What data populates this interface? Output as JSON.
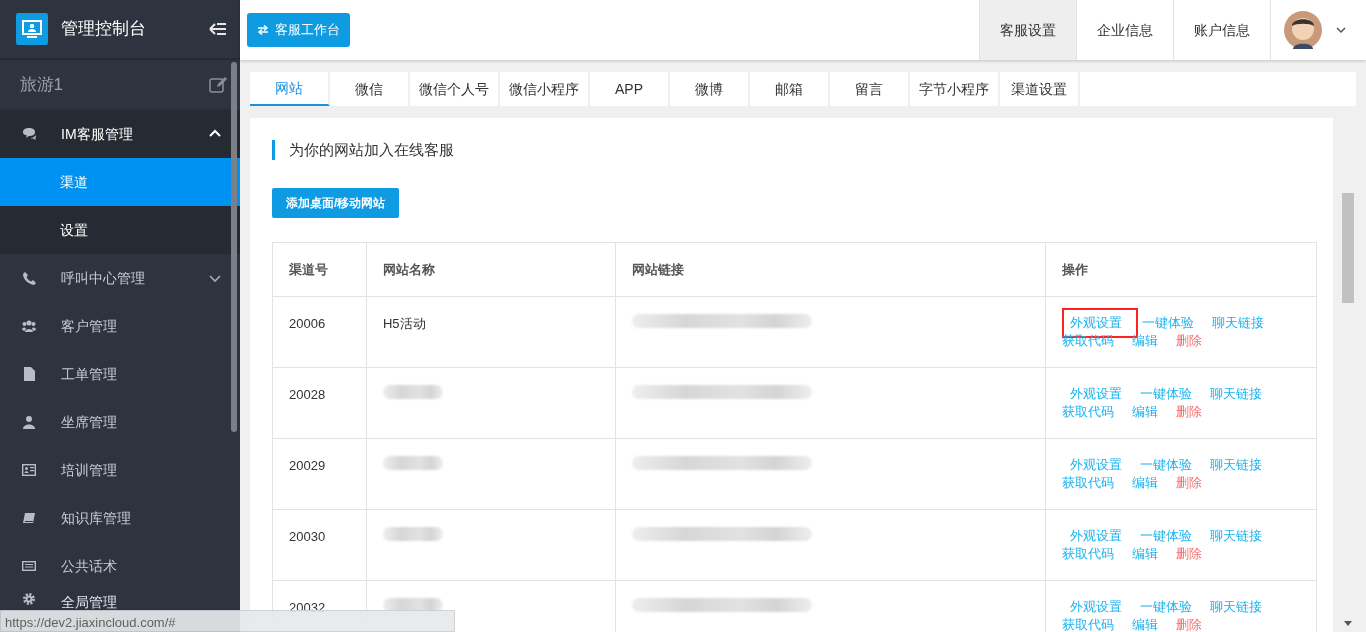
{
  "sidebar": {
    "title": "管理控制台",
    "account": "旅游1",
    "items": [
      {
        "label": "IM客服管理",
        "expanded": true,
        "children": [
          {
            "label": "渠道",
            "selected": true
          },
          {
            "label": "设置",
            "selected": false
          }
        ]
      },
      {
        "label": "呼叫中心管理",
        "expanded": false
      },
      {
        "label": "客户管理"
      },
      {
        "label": "工单管理"
      },
      {
        "label": "坐席管理"
      },
      {
        "label": "培训管理"
      },
      {
        "label": "知识库管理"
      },
      {
        "label": "公共话术"
      },
      {
        "label": "全局管理"
      }
    ]
  },
  "header": {
    "workbench_button": "客服工作台",
    "nav": [
      {
        "label": "客服设置",
        "selected": true
      },
      {
        "label": "企业信息",
        "selected": false
      },
      {
        "label": "账户信息",
        "selected": false
      }
    ]
  },
  "tabs": [
    {
      "label": "网站",
      "selected": true
    },
    {
      "label": "微信",
      "selected": false
    },
    {
      "label": "微信个人号",
      "selected": false
    },
    {
      "label": "微信小程序",
      "selected": false
    },
    {
      "label": "APP",
      "selected": false
    },
    {
      "label": "微博",
      "selected": false
    },
    {
      "label": "邮箱",
      "selected": false
    },
    {
      "label": "留言",
      "selected": false
    },
    {
      "label": "字节小程序",
      "selected": false
    },
    {
      "label": "渠道设置",
      "selected": false
    }
  ],
  "section_title": "为你的网站加入在线客服",
  "add_button": "添加桌面/移动网站",
  "table": {
    "columns": [
      "渠道号",
      "网站名称",
      "网站链接",
      "操作"
    ],
    "rows": [
      {
        "channel": "20006",
        "name": "H5活动",
        "name_redacted": false,
        "link_redacted": true,
        "actions": [
          {
            "label": "外观设置",
            "kind": "link",
            "highlighted": true
          },
          {
            "label": "一键体验",
            "kind": "link",
            "highlighted": false
          },
          {
            "label": "聊天链接",
            "kind": "link",
            "highlighted": false
          },
          {
            "label": "获取代码",
            "kind": "link",
            "highlighted": false
          },
          {
            "label": "编辑",
            "kind": "link",
            "highlighted": false
          },
          {
            "label": "删除",
            "kind": "danger",
            "highlighted": false
          }
        ]
      },
      {
        "channel": "20028",
        "name_redacted": true,
        "link_redacted": true,
        "actions": [
          {
            "label": "外观设置",
            "kind": "link",
            "highlighted": false
          },
          {
            "label": "一键体验",
            "kind": "link",
            "highlighted": false
          },
          {
            "label": "聊天链接",
            "kind": "link",
            "highlighted": false
          },
          {
            "label": "获取代码",
            "kind": "link",
            "highlighted": false
          },
          {
            "label": "编辑",
            "kind": "link",
            "highlighted": false
          },
          {
            "label": "删除",
            "kind": "danger",
            "highlighted": false
          }
        ]
      },
      {
        "channel": "20029",
        "name_redacted": true,
        "link_redacted": true,
        "actions": [
          {
            "label": "外观设置",
            "kind": "link",
            "highlighted": false
          },
          {
            "label": "一键体验",
            "kind": "link",
            "highlighted": false
          },
          {
            "label": "聊天链接",
            "kind": "link",
            "highlighted": false
          },
          {
            "label": "获取代码",
            "kind": "link",
            "highlighted": false
          },
          {
            "label": "编辑",
            "kind": "link",
            "highlighted": false
          },
          {
            "label": "删除",
            "kind": "danger",
            "highlighted": false
          }
        ]
      },
      {
        "channel": "20030",
        "name_redacted": true,
        "link_redacted": true,
        "actions": [
          {
            "label": "外观设置",
            "kind": "link",
            "highlighted": false
          },
          {
            "label": "一键体验",
            "kind": "link",
            "highlighted": false
          },
          {
            "label": "聊天链接",
            "kind": "link",
            "highlighted": false
          },
          {
            "label": "获取代码",
            "kind": "link",
            "highlighted": false
          },
          {
            "label": "编辑",
            "kind": "link",
            "highlighted": false
          },
          {
            "label": "删除",
            "kind": "danger",
            "highlighted": false
          }
        ]
      },
      {
        "channel": "20032",
        "name_redacted": true,
        "link_redacted": true,
        "actions": [
          {
            "label": "外观设置",
            "kind": "link",
            "highlighted": false
          },
          {
            "label": "一键体验",
            "kind": "link",
            "highlighted": false
          },
          {
            "label": "聊天链接",
            "kind": "link",
            "highlighted": false
          },
          {
            "label": "获取代码",
            "kind": "link",
            "highlighted": false
          },
          {
            "label": "编辑",
            "kind": "link",
            "highlighted": false
          },
          {
            "label": "删除",
            "kind": "danger",
            "highlighted": false
          }
        ]
      }
    ]
  },
  "status_url": "https://dev2.jiaxincloud.com/#"
}
